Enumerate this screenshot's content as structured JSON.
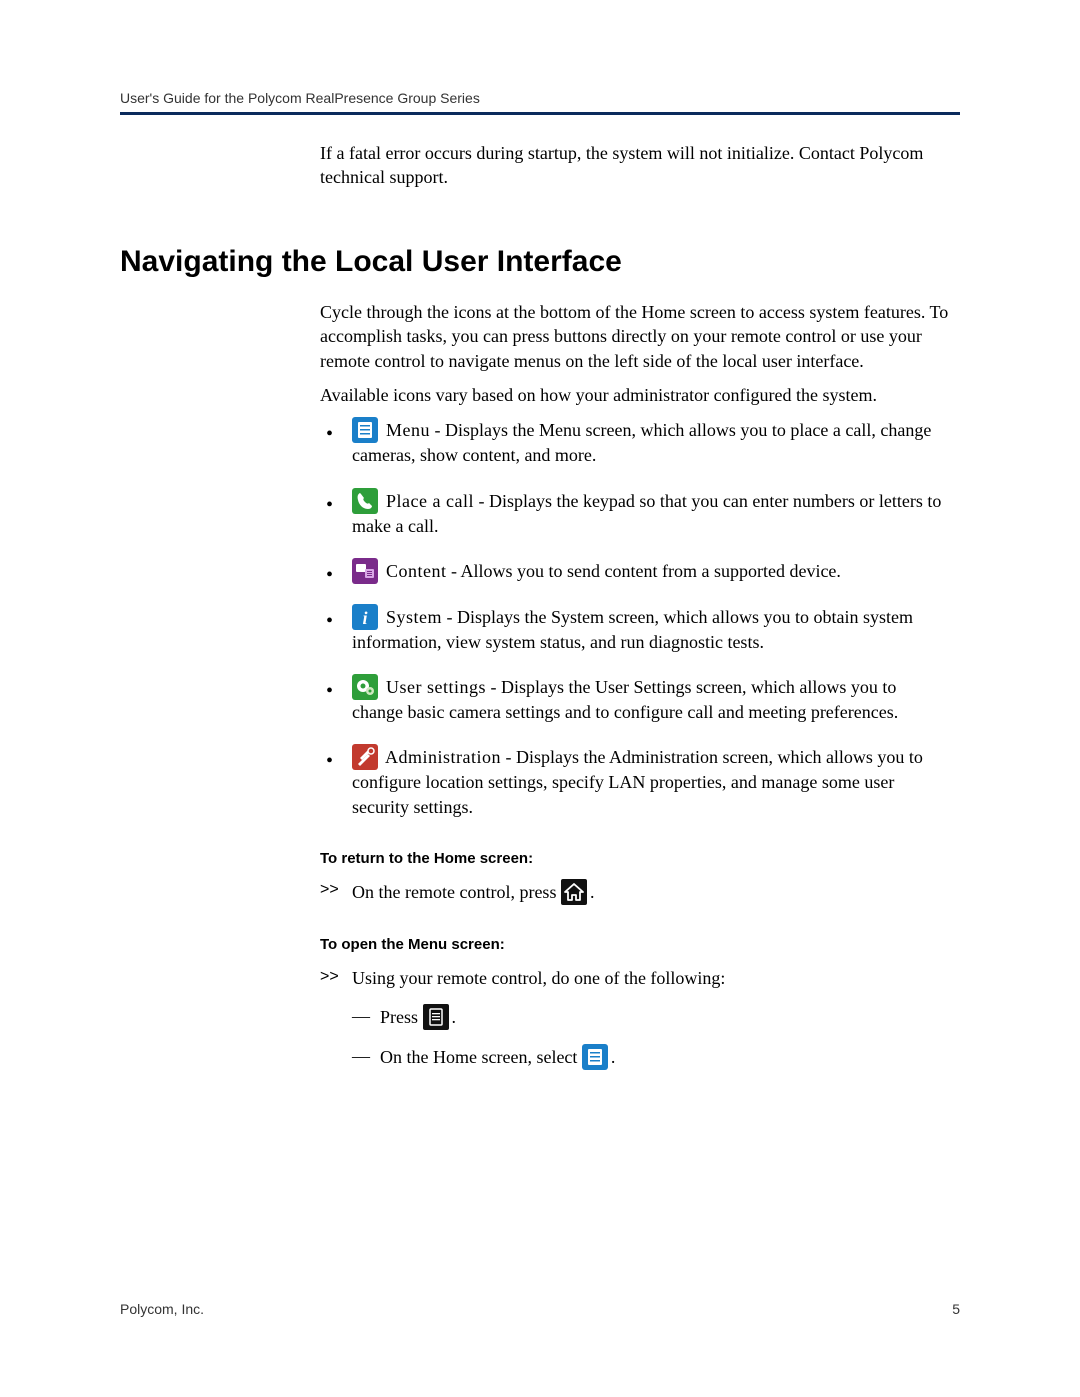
{
  "header": {
    "running": "User's Guide for the Polycom RealPresence Group Series"
  },
  "intro": "If a fatal error occurs during startup, the system will not initialize. Contact Polycom technical support.",
  "section_title": "Navigating the Local User Interface",
  "body1": "Cycle through the icons at the bottom of the Home screen to access system features. To accomplish tasks, you can press buttons directly on your remote control or use your remote control to navigate menus on the left side of the local user interface.",
  "body2": "Available icons vary based on how your administrator configured the system.",
  "items": [
    {
      "icon": "menu-icon",
      "term": " Menu",
      "desc": " - Displays the Menu screen, which allows you to place a call, change cameras, show content, and more."
    },
    {
      "icon": "phone-icon",
      "term": " Place a call",
      "desc": " - Displays the keypad so that you can enter numbers or letters to make a call."
    },
    {
      "icon": "content-icon",
      "term": " Content",
      "desc": " - Allows you to send content from a supported device."
    },
    {
      "icon": "info-icon",
      "term": " System",
      "desc": " - Displays the System screen, which allows you to obtain system information, view system status, and run diagnostic tests."
    },
    {
      "icon": "gear-icon",
      "term": " User settings",
      "desc": " - Displays the User Settings screen, which allows you to change basic camera settings and to configure call and meeting preferences."
    },
    {
      "icon": "tools-icon",
      "term": " Administration",
      "desc": " - Displays the Administration screen, which allows you to configure location settings, specify LAN properties, and manage some user security settings."
    }
  ],
  "proc1_head": "To return to the Home screen:",
  "proc1_step_a": "On the remote control, press ",
  "proc1_step_b": ".",
  "proc2_head": "To open the Menu screen:",
  "proc2_step": "Using your remote control, do one of the following:",
  "proc2_sub1_a": "Press ",
  "proc2_sub1_b": ".",
  "proc2_sub2_a": "On the Home screen, select ",
  "proc2_sub2_b": ".",
  "footer": {
    "left": "Polycom, Inc.",
    "right": "5"
  }
}
